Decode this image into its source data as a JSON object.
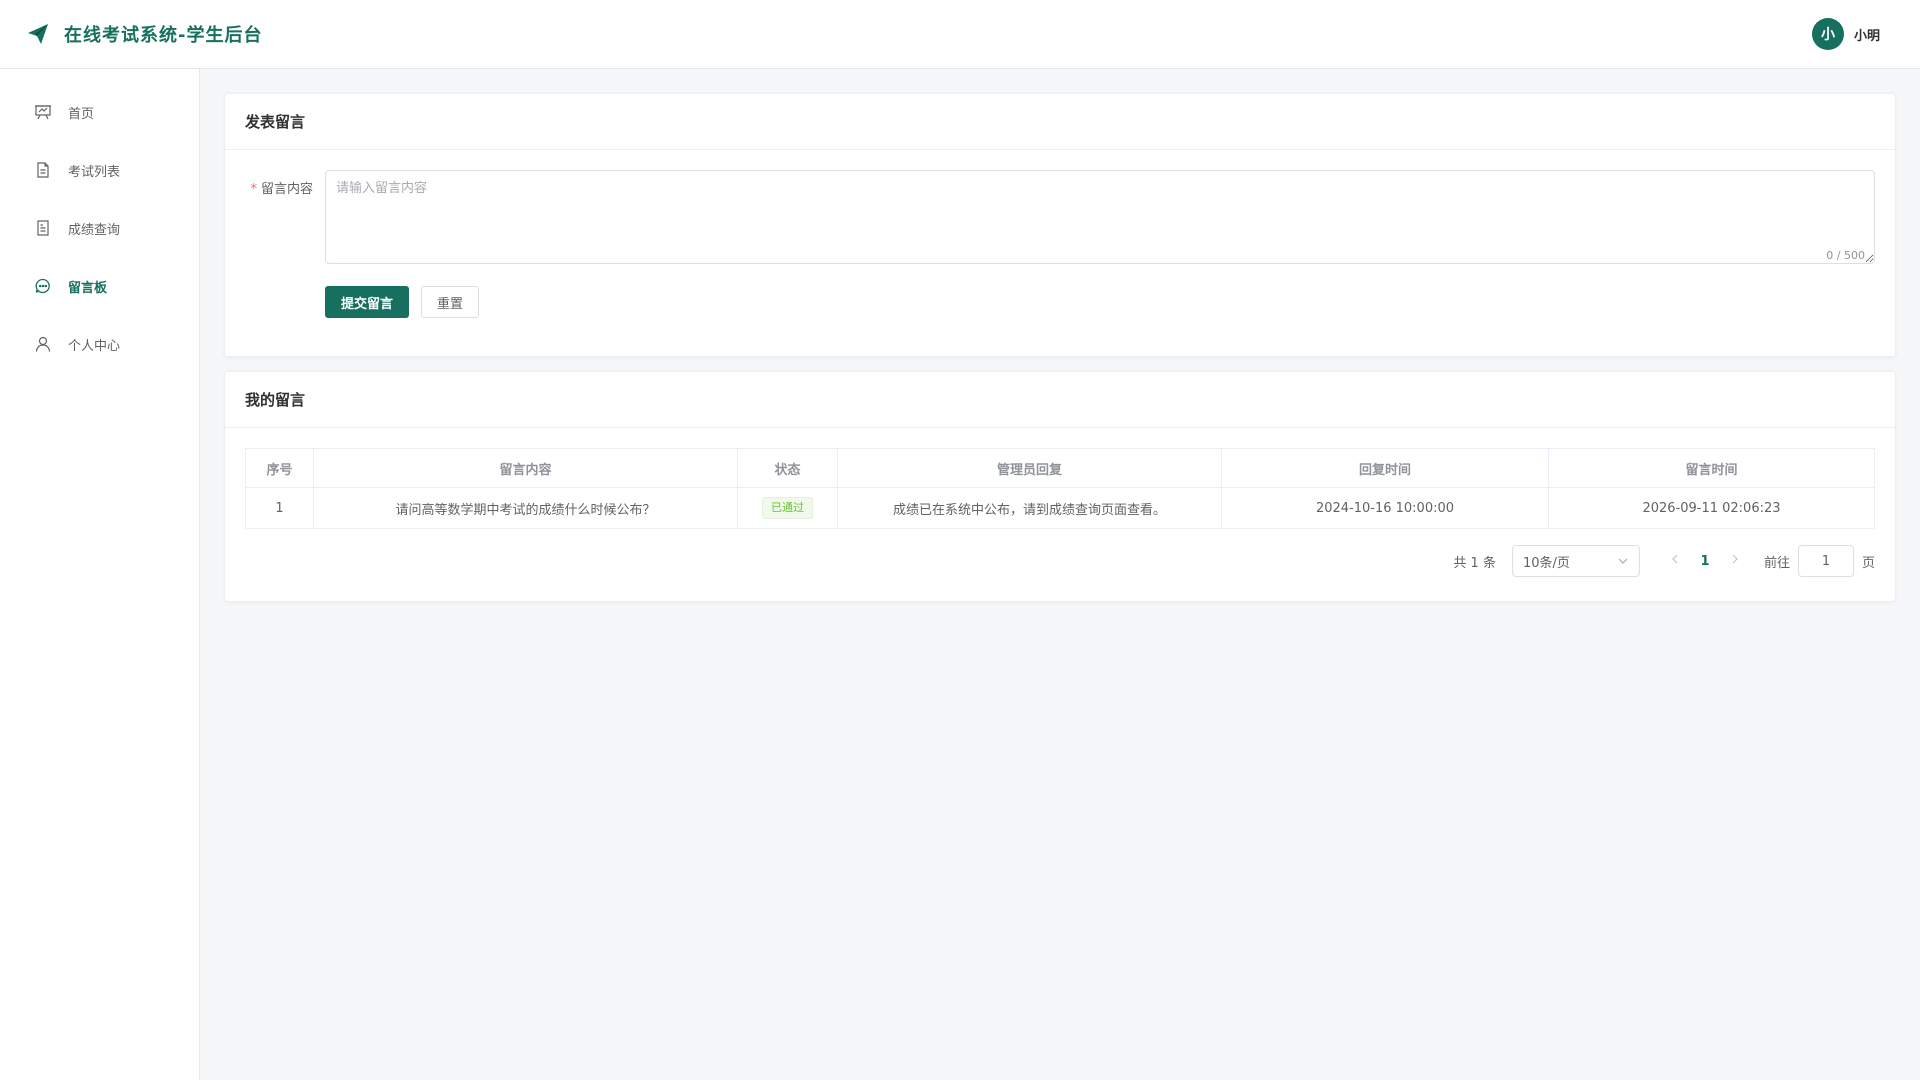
{
  "header": {
    "title": "在线考试系统-学生后台",
    "avatar_text": "小",
    "username": "小明"
  },
  "sidebar": {
    "items": [
      {
        "label": "首页",
        "icon": "presentation-icon"
      },
      {
        "label": "考试列表",
        "icon": "document-icon"
      },
      {
        "label": "成绩查询",
        "icon": "tickets-icon"
      },
      {
        "label": "留言板",
        "icon": "chat-icon",
        "active": true
      },
      {
        "label": "个人中心",
        "icon": "user-icon"
      }
    ]
  },
  "post_form": {
    "title": "发表留言",
    "required_mark": "*",
    "label": "留言内容",
    "value": "",
    "placeholder": "请输入留言内容",
    "counter": "0 / 500",
    "submit_label": "提交留言",
    "reset_label": "重置"
  },
  "my_messages": {
    "title": "我的留言",
    "columns": [
      "序号",
      "留言内容",
      "状态",
      "管理员回复",
      "回复时间",
      "留言时间"
    ],
    "rows": [
      {
        "index": "1",
        "content": "请问高等数学期中考试的成绩什么时候公布？",
        "status": "已通过",
        "reply": "成绩已在系统中公布，请到成绩查询页面查看。",
        "reply_time": "2024-10-16 10:00:00",
        "post_time": "2026-09-11 02:06:23"
      }
    ]
  },
  "pagination": {
    "total": "共 1 条",
    "page_size": "10条/页",
    "current_page": "1",
    "goto_label": "前往",
    "goto_value": "1",
    "goto_suffix": "页"
  },
  "colors": {
    "primary": "#17705f",
    "success": "#67c23a"
  }
}
